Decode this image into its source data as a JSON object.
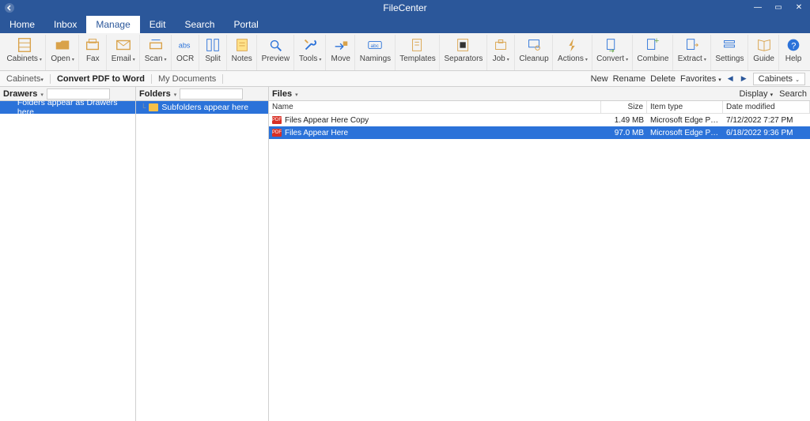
{
  "app": {
    "title": "FileCenter"
  },
  "wincontrols": {
    "min": "—",
    "max": "▭",
    "close": "✕"
  },
  "menubar": [
    {
      "label": "Home",
      "active": false
    },
    {
      "label": "Inbox",
      "active": false
    },
    {
      "label": "Manage",
      "active": true
    },
    {
      "label": "Edit",
      "active": false
    },
    {
      "label": "Search",
      "active": false
    },
    {
      "label": "Portal",
      "active": false
    }
  ],
  "ribbon": [
    {
      "label": "Cabinets",
      "hasCaret": true,
      "icon": "cabinets"
    },
    {
      "label": "Open",
      "hasCaret": true,
      "icon": "open"
    },
    {
      "label": "Fax",
      "hasCaret": false,
      "icon": "fax"
    },
    {
      "label": "Email",
      "hasCaret": true,
      "icon": "email"
    },
    {
      "label": "Scan",
      "hasCaret": true,
      "icon": "scan"
    },
    {
      "label": "OCR",
      "hasCaret": false,
      "icon": "ocr"
    },
    {
      "label": "Split",
      "hasCaret": false,
      "icon": "split"
    },
    {
      "label": "Notes",
      "hasCaret": false,
      "icon": "notes"
    },
    {
      "label": "Preview",
      "hasCaret": false,
      "icon": "preview"
    },
    {
      "label": "Tools",
      "hasCaret": true,
      "icon": "tools"
    },
    {
      "label": "Move",
      "hasCaret": false,
      "icon": "move"
    },
    {
      "label": "Namings",
      "hasCaret": false,
      "icon": "namings"
    },
    {
      "label": "Templates",
      "hasCaret": false,
      "icon": "templates"
    },
    {
      "label": "Separators",
      "hasCaret": false,
      "icon": "separators"
    },
    {
      "label": "Job",
      "hasCaret": true,
      "icon": "job"
    },
    {
      "label": "Cleanup",
      "hasCaret": false,
      "icon": "cleanup"
    },
    {
      "label": "Actions",
      "hasCaret": true,
      "icon": "actions"
    },
    {
      "label": "Convert",
      "hasCaret": true,
      "icon": "convert"
    },
    {
      "label": "Combine",
      "hasCaret": false,
      "icon": "combine"
    },
    {
      "label": "Extract",
      "hasCaret": true,
      "icon": "extract"
    },
    {
      "label": "Settings",
      "hasCaret": false,
      "icon": "settings"
    },
    {
      "label": "Guide",
      "hasCaret": false,
      "icon": "guide"
    },
    {
      "label": "Help",
      "hasCaret": false,
      "icon": "help"
    }
  ],
  "subbar": {
    "left": [
      {
        "label": "Cabinets",
        "caret": true
      },
      {
        "label": "Convert PDF to Word",
        "caret": false,
        "active": true
      },
      {
        "label": "My Documents",
        "caret": false
      }
    ],
    "right": {
      "new": "New",
      "rename": "Rename",
      "delete": "Delete",
      "favorites": "Favorites",
      "cabinets": "Cabinets"
    }
  },
  "drawers": {
    "title": "Drawers",
    "item": "Folders appear as Drawers here"
  },
  "folders": {
    "title": "Folders",
    "item": "Subfolders appear here"
  },
  "files": {
    "title": "Files",
    "display": "Display",
    "search": "Search",
    "columns": {
      "name": "Name",
      "size": "Size",
      "type": "Item type",
      "date": "Date modified"
    },
    "rows": [
      {
        "name": "Files Appear Here Copy",
        "size": "1.49 MB",
        "type": "Microsoft Edge PD...",
        "date": "7/12/2022 7:27 PM",
        "selected": false
      },
      {
        "name": "Files Appear Here",
        "size": "97.0 MB",
        "type": "Microsoft Edge PD...",
        "date": "6/18/2022 9:36 PM",
        "selected": true
      }
    ]
  }
}
